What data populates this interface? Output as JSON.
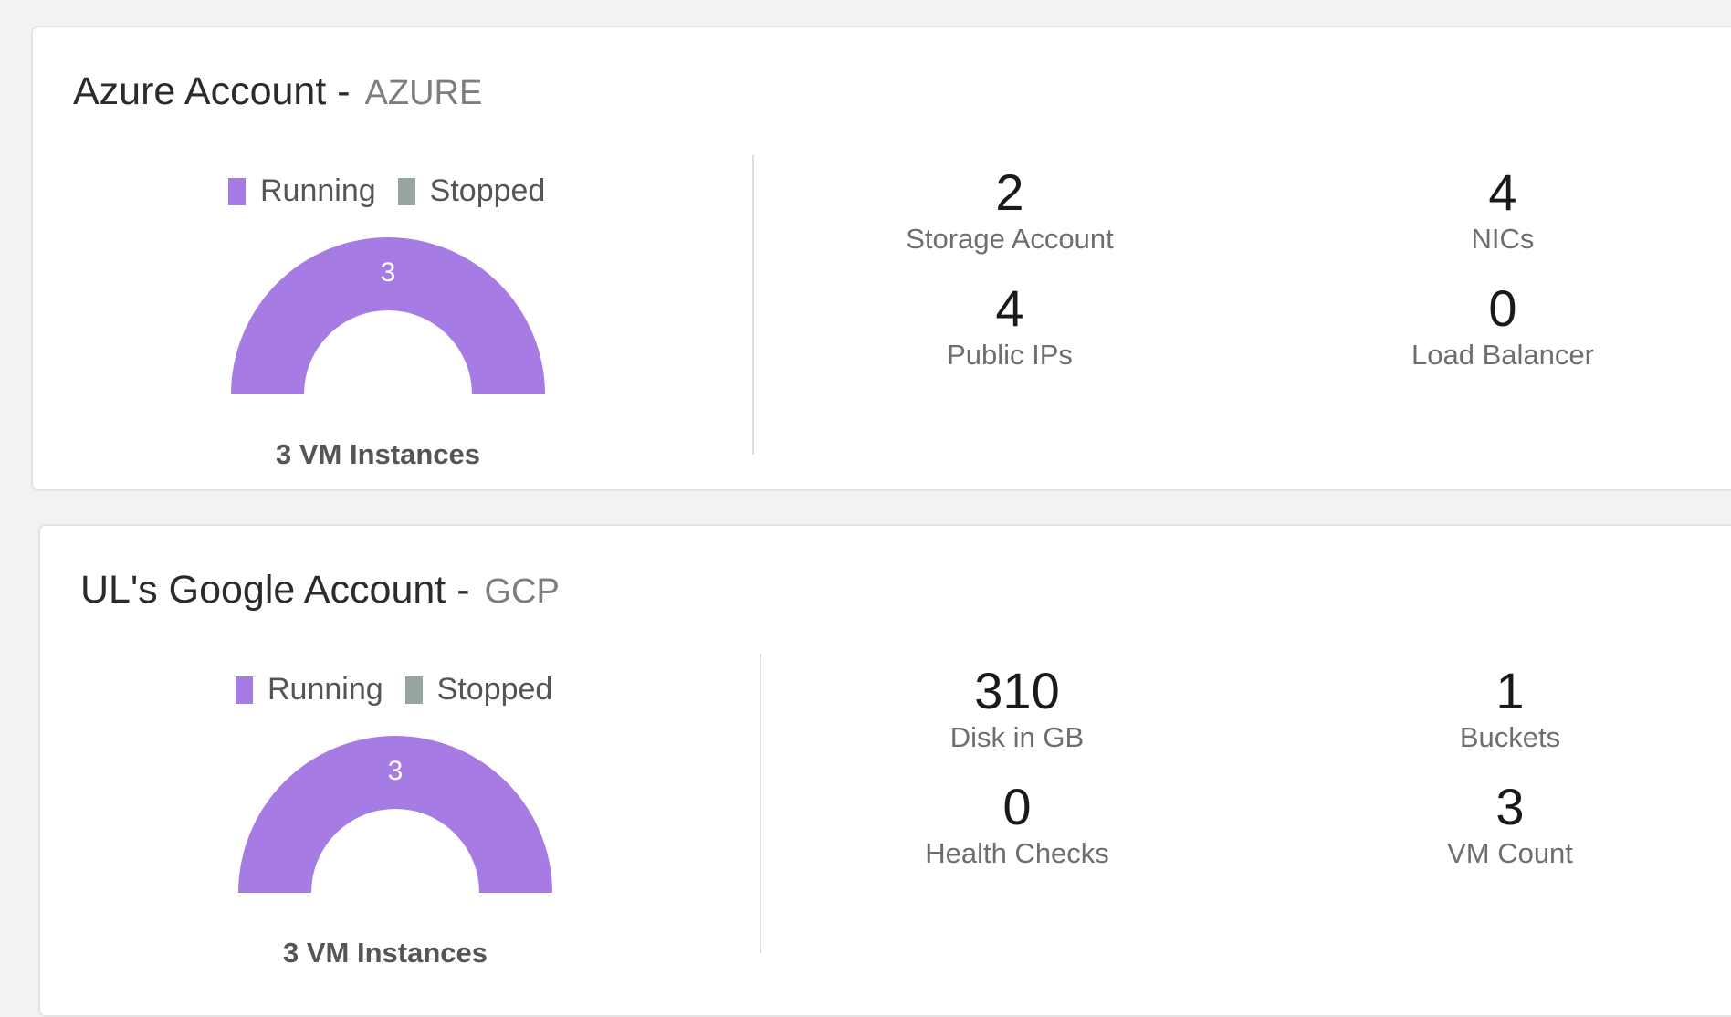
{
  "accounts": [
    {
      "name": "Azure Account",
      "separator": "-",
      "provider": "AZURE",
      "legend": {
        "running_label": "Running",
        "stopped_label": "Stopped",
        "running_color": "#a67ce4",
        "stopped_color": "#98a59e"
      },
      "gauge": {
        "running": 3,
        "stopped": 0,
        "running_label": "3"
      },
      "caption": "3 VM Instances",
      "stats": [
        {
          "value": "2",
          "label": "Storage Account"
        },
        {
          "value": "4",
          "label": "NICs"
        },
        {
          "value": "4",
          "label": "Public IPs"
        },
        {
          "value": "0",
          "label": "Load Balancer"
        }
      ]
    },
    {
      "name": "UL's Google Account",
      "separator": "-",
      "provider": "GCP",
      "legend": {
        "running_label": "Running",
        "stopped_label": "Stopped",
        "running_color": "#a67ce4",
        "stopped_color": "#98a59e"
      },
      "gauge": {
        "running": 3,
        "stopped": 0,
        "running_label": "3"
      },
      "caption": "3 VM Instances",
      "stats": [
        {
          "value": "310",
          "label": "Disk in GB"
        },
        {
          "value": "1",
          "label": "Buckets"
        },
        {
          "value": "0",
          "label": "Health Checks"
        },
        {
          "value": "3",
          "label": "VM Count"
        }
      ]
    }
  ]
}
